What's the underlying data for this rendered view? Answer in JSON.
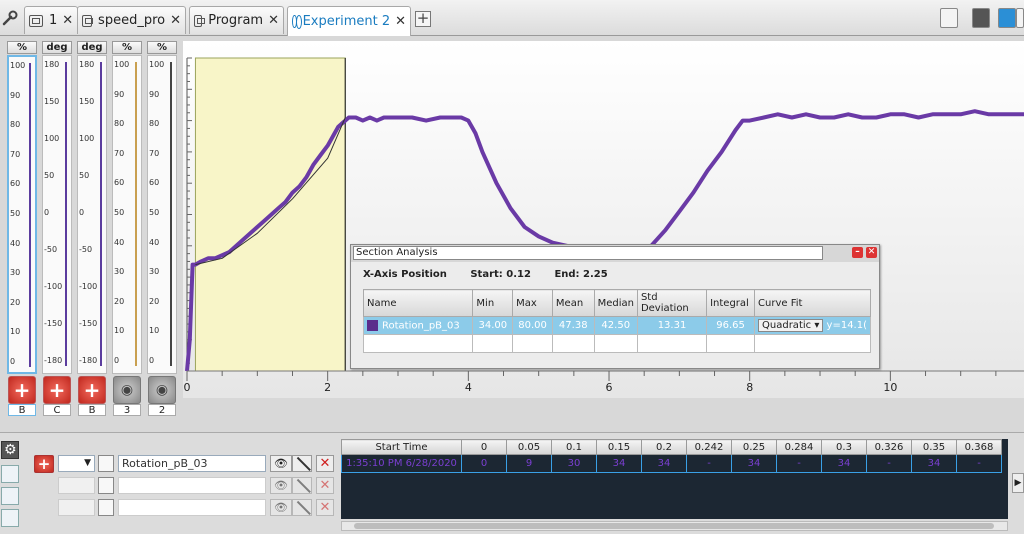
{
  "tabs": [
    {
      "label": "1"
    },
    {
      "label": "speed_pro"
    },
    {
      "label": "Program"
    },
    {
      "label": "Experiment 2"
    }
  ],
  "meters": [
    {
      "unit": "%",
      "port": "B",
      "color": "#5b3c9e",
      "ticks": [
        "100",
        "90",
        "80",
        "70",
        "60",
        "50",
        "40",
        "30",
        "20",
        "10",
        "0"
      ]
    },
    {
      "unit": "deg",
      "port": "C",
      "color": "#5b3c9e",
      "ticks": [
        "180",
        "150",
        "100",
        "50",
        "0",
        "-50",
        "-100",
        "-150",
        "-180"
      ]
    },
    {
      "unit": "deg",
      "port": "B",
      "color": "#5b3c9e",
      "ticks": [
        "180",
        "150",
        "100",
        "50",
        "0",
        "-50",
        "-100",
        "-150",
        "-180"
      ]
    },
    {
      "unit": "%",
      "port": "3",
      "color": "#c9a050",
      "ticks": [
        "100",
        "90",
        "80",
        "70",
        "60",
        "50",
        "40",
        "30",
        "20",
        "10",
        "0"
      ]
    },
    {
      "unit": "%",
      "port": "2",
      "color": "#444444",
      "ticks": [
        "100",
        "90",
        "80",
        "70",
        "60",
        "50",
        "40",
        "30",
        "20",
        "10",
        "0"
      ]
    }
  ],
  "chart_data": {
    "type": "line",
    "xlim": [
      0,
      11.9
    ],
    "ylim": [
      0,
      100
    ],
    "x_ticks": [
      "0",
      "2",
      "4",
      "6",
      "8",
      "10"
    ],
    "series": [
      {
        "color": "#6a3aa6",
        "x": [
          0,
          0.04,
          0.08,
          0.12,
          0.2,
          0.3,
          0.4,
          0.5,
          0.6,
          0.7,
          0.8,
          0.9,
          1.0,
          1.1,
          1.2,
          1.3,
          1.4,
          1.5,
          1.6,
          1.7,
          1.8,
          1.9,
          2.0,
          2.05,
          2.1,
          2.15,
          2.2,
          2.25,
          2.3,
          2.4,
          2.5,
          2.6,
          2.7,
          2.8,
          3.0,
          3.2,
          3.4,
          3.6,
          3.8,
          3.9,
          4.0,
          4.1,
          4.2,
          4.4,
          4.6,
          4.8,
          5.0,
          5.2,
          5.4,
          5.6,
          5.8,
          6.0,
          6.2,
          6.4,
          6.6,
          6.8,
          7.0,
          7.2,
          7.4,
          7.6,
          7.8,
          7.9,
          8.0,
          8.2,
          8.4,
          8.6,
          8.8,
          9.0,
          9.2,
          9.4,
          9.6,
          9.8,
          10.0,
          10.2,
          10.4,
          10.6,
          10.8,
          11.0,
          11.2,
          11.4,
          11.6,
          11.9
        ],
        "y": [
          0,
          10,
          34,
          34,
          35,
          36,
          36,
          37,
          38,
          40,
          42,
          44,
          46,
          48,
          50,
          52,
          54,
          57,
          59,
          62,
          66,
          69,
          72,
          74,
          76,
          78,
          79,
          80,
          81,
          81,
          80,
          81,
          80,
          81,
          81,
          81,
          80,
          81,
          81,
          81,
          80,
          76,
          70,
          60,
          52,
          46,
          43,
          41,
          40,
          39,
          39,
          38,
          38,
          39,
          40,
          45,
          51,
          57,
          64,
          70,
          77,
          80,
          80,
          81,
          82,
          81,
          82,
          81,
          81,
          82,
          81,
          81,
          82,
          82,
          81,
          82,
          82,
          82,
          83,
          82,
          82,
          82
        ],
        "name": ""
      },
      {
        "color": "#333333",
        "x": [
          0.12,
          0.5,
          1.0,
          1.5,
          2.0,
          2.25
        ],
        "y": [
          34,
          36,
          44,
          55,
          68,
          81
        ],
        "name": ""
      }
    ],
    "selection": [
      0.12,
      2.25
    ],
    "cursor_x": 2.25
  },
  "analysis": {
    "title": "Section Analysis",
    "position_label": "X-Axis Position",
    "start": "Start: 0.12",
    "end": "End: 2.25",
    "columns": [
      "Name",
      "Min",
      "Max",
      "Mean",
      "Median",
      "Std Deviation",
      "Integral",
      "Curve Fit"
    ],
    "row": {
      "name": "Rotation_pB_03",
      "min": "34.00",
      "max": "80.00",
      "mean": "47.38",
      "median": "42.50",
      "std": "13.31",
      "integral": "96.65",
      "fit": "Quadratic",
      "eq": "y=14.1("
    }
  },
  "datasets": [
    {
      "name": "Rotation_pB_03"
    },
    {
      "name": ""
    },
    {
      "name": ""
    }
  ],
  "datagrid": {
    "headers": [
      "Start Time",
      "0",
      "0.05",
      "0.1",
      "0.15",
      "0.2",
      "0.242",
      "0.25",
      "0.284",
      "0.3",
      "0.326",
      "0.35",
      "0.368"
    ],
    "row": [
      "1:35:10 PM 6/28/2020",
      "0",
      "9",
      "30",
      "34",
      "34",
      "-",
      "34",
      "-",
      "34",
      "-",
      "34",
      "-"
    ]
  }
}
